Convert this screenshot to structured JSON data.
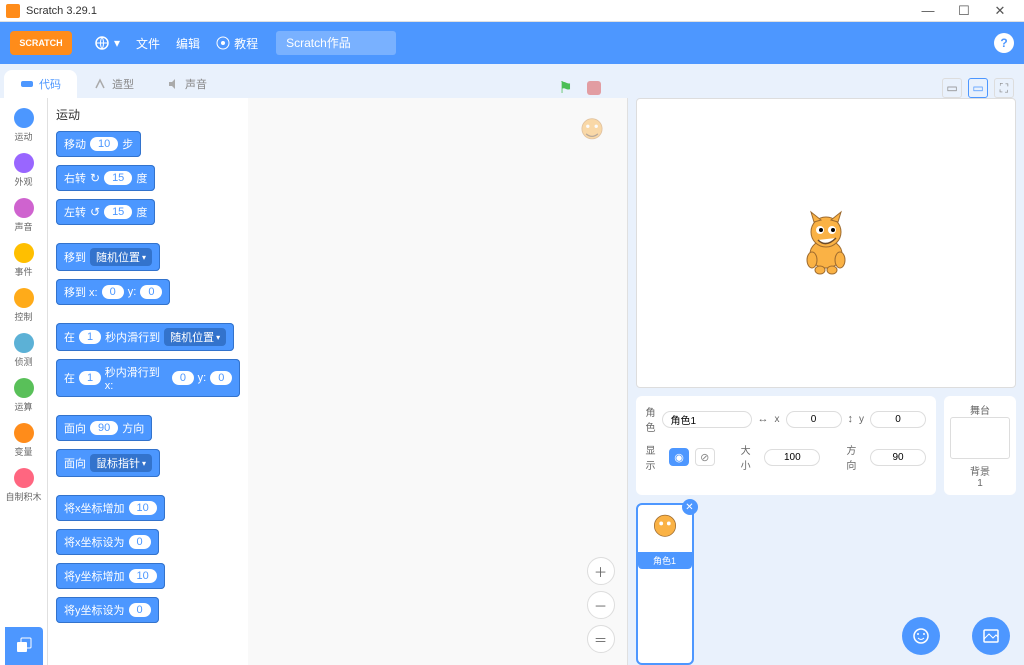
{
  "window": {
    "title": "Scratch 3.29.1"
  },
  "menu": {
    "file": "文件",
    "edit": "编辑",
    "tutorials": "教程",
    "project_placeholder": "Scratch作品"
  },
  "tabs": {
    "code": "代码",
    "costumes": "造型",
    "sounds": "声音"
  },
  "categories": [
    {
      "label": "运动",
      "color": "#4c97ff"
    },
    {
      "label": "外观",
      "color": "#9966ff"
    },
    {
      "label": "声音",
      "color": "#cf63cf"
    },
    {
      "label": "事件",
      "color": "#ffbf00"
    },
    {
      "label": "控制",
      "color": "#ffab19"
    },
    {
      "label": "侦测",
      "color": "#5cb1d6"
    },
    {
      "label": "运算",
      "color": "#59c059"
    },
    {
      "label": "变量",
      "color": "#ff8c1a"
    },
    {
      "label": "自制积木",
      "color": "#ff6680"
    }
  ],
  "palette": {
    "heading": "运动",
    "blocks": {
      "move": {
        "pre": "移动",
        "val": "10",
        "post": "步"
      },
      "turn_r": {
        "pre": "右转",
        "icon": "↻",
        "val": "15",
        "post": "度"
      },
      "turn_l": {
        "pre": "左转",
        "icon": "↺",
        "val": "15",
        "post": "度"
      },
      "goto": {
        "pre": "移到",
        "drop": "随机位置"
      },
      "goto_xy": {
        "pre": "移到 x:",
        "x": "0",
        "mid": "y:",
        "y": "0"
      },
      "glide": {
        "pre": "在",
        "sec": "1",
        "mid": "秒内滑行到",
        "drop": "随机位置"
      },
      "glide_xy": {
        "pre": "在",
        "sec": "1",
        "mid": "秒内滑行到 x:",
        "x": "0",
        "mid2": "y:",
        "y": "0"
      },
      "point_dir": {
        "pre": "面向",
        "val": "90",
        "post": "方向"
      },
      "point_to": {
        "pre": "面向",
        "drop": "鼠标指针"
      },
      "change_x": {
        "pre": "将x坐标增加",
        "val": "10"
      },
      "set_x": {
        "pre": "将x坐标设为",
        "val": "0"
      },
      "change_y": {
        "pre": "将y坐标增加",
        "val": "10"
      },
      "set_y": {
        "pre": "将y坐标设为",
        "val": "0"
      }
    }
  },
  "sprite": {
    "label_sprite": "角色",
    "name": "角色1",
    "label_x": "x",
    "x": "0",
    "label_y": "y",
    "y": "0",
    "label_show": "显示",
    "label_size": "大小",
    "size": "100",
    "label_dir": "方向",
    "dir": "90"
  },
  "stage_panel": {
    "label": "舞台",
    "backdrops_label": "背景",
    "backdrops_count": "1"
  },
  "sprite_card": {
    "name": "角色1"
  }
}
